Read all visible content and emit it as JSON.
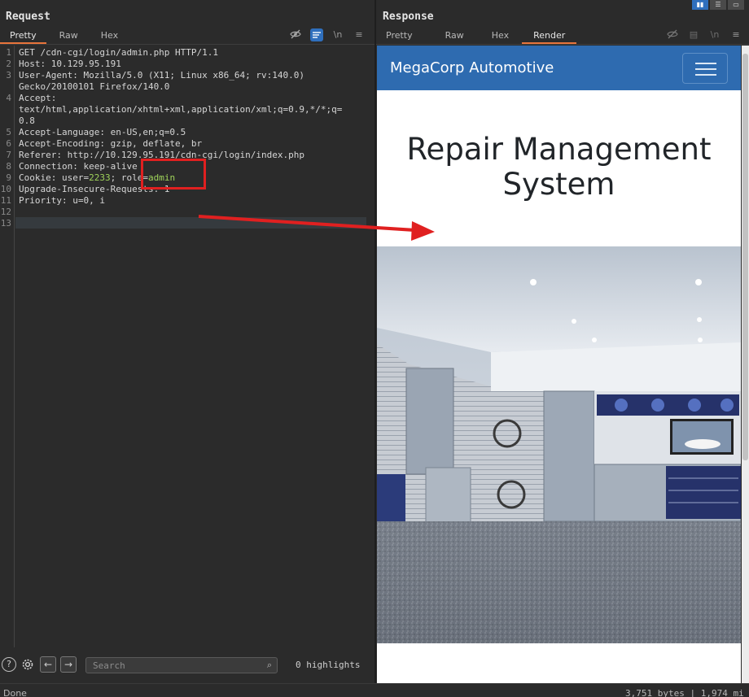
{
  "request": {
    "title": "Request",
    "tabs": [
      "Pretty",
      "Raw",
      "Hex"
    ],
    "active_tab": "Pretty",
    "toolbar_icons": [
      "eye-off-icon",
      "wrap-icon",
      "newline-toggle",
      "menu-icon"
    ],
    "newline_label": "\\n",
    "lines": [
      {
        "n": "1",
        "text": "GET /cdn-cgi/login/admin.php HTTP/1.1"
      },
      {
        "n": "2",
        "text": "Host: 10.129.95.191"
      },
      {
        "n": "3",
        "text": "User-Agent: Mozilla/5.0 (X11; Linux x86_64; rv:140.0)"
      },
      {
        "n": "",
        "text": "Gecko/20100101 Firefox/140.0"
      },
      {
        "n": "4",
        "text": "Accept:"
      },
      {
        "n": "",
        "text": "text/html,application/xhtml+xml,application/xml;q=0.9,*/*;q="
      },
      {
        "n": "",
        "text": "0.8"
      },
      {
        "n": "5",
        "text": "Accept-Language: en-US,en;q=0.5"
      },
      {
        "n": "6",
        "text": "Accept-Encoding: gzip, deflate, br"
      },
      {
        "n": "7",
        "text": "Referer: http://10.129.95.191/cdn-cgi/login/index.php"
      },
      {
        "n": "8",
        "text": "Connection: keep-alive"
      },
      {
        "n": "9",
        "text": "Cookie: user=2233; role=admin"
      },
      {
        "n": "10",
        "text": "Upgrade-Insecure-Requests: 1"
      },
      {
        "n": "11",
        "text": "Priority: u=0, i"
      },
      {
        "n": "12",
        "text": ""
      },
      {
        "n": "13",
        "text": ""
      }
    ],
    "cookie": {
      "prefix": "Cookie: user=",
      "user": "2233",
      "mid": "; role=",
      "role": "admin"
    },
    "search_placeholder": "Search",
    "highlights": "0 highlights"
  },
  "response": {
    "title": "Response",
    "tabs": [
      "Pretty",
      "Raw",
      "Hex",
      "Render"
    ],
    "active_tab": "Render",
    "render": {
      "brand": "MegaCorp Automotive",
      "heading_line1": "Repair Management",
      "heading_line2": "System",
      "image": "garage-photo"
    }
  },
  "status": {
    "left": "Done",
    "right": "3,751 bytes | 1,974 mi"
  },
  "colors": {
    "accent": "#e8743b",
    "navbar": "#2e6bb0",
    "annotation": "#e02020",
    "value": "#9fd35a"
  }
}
